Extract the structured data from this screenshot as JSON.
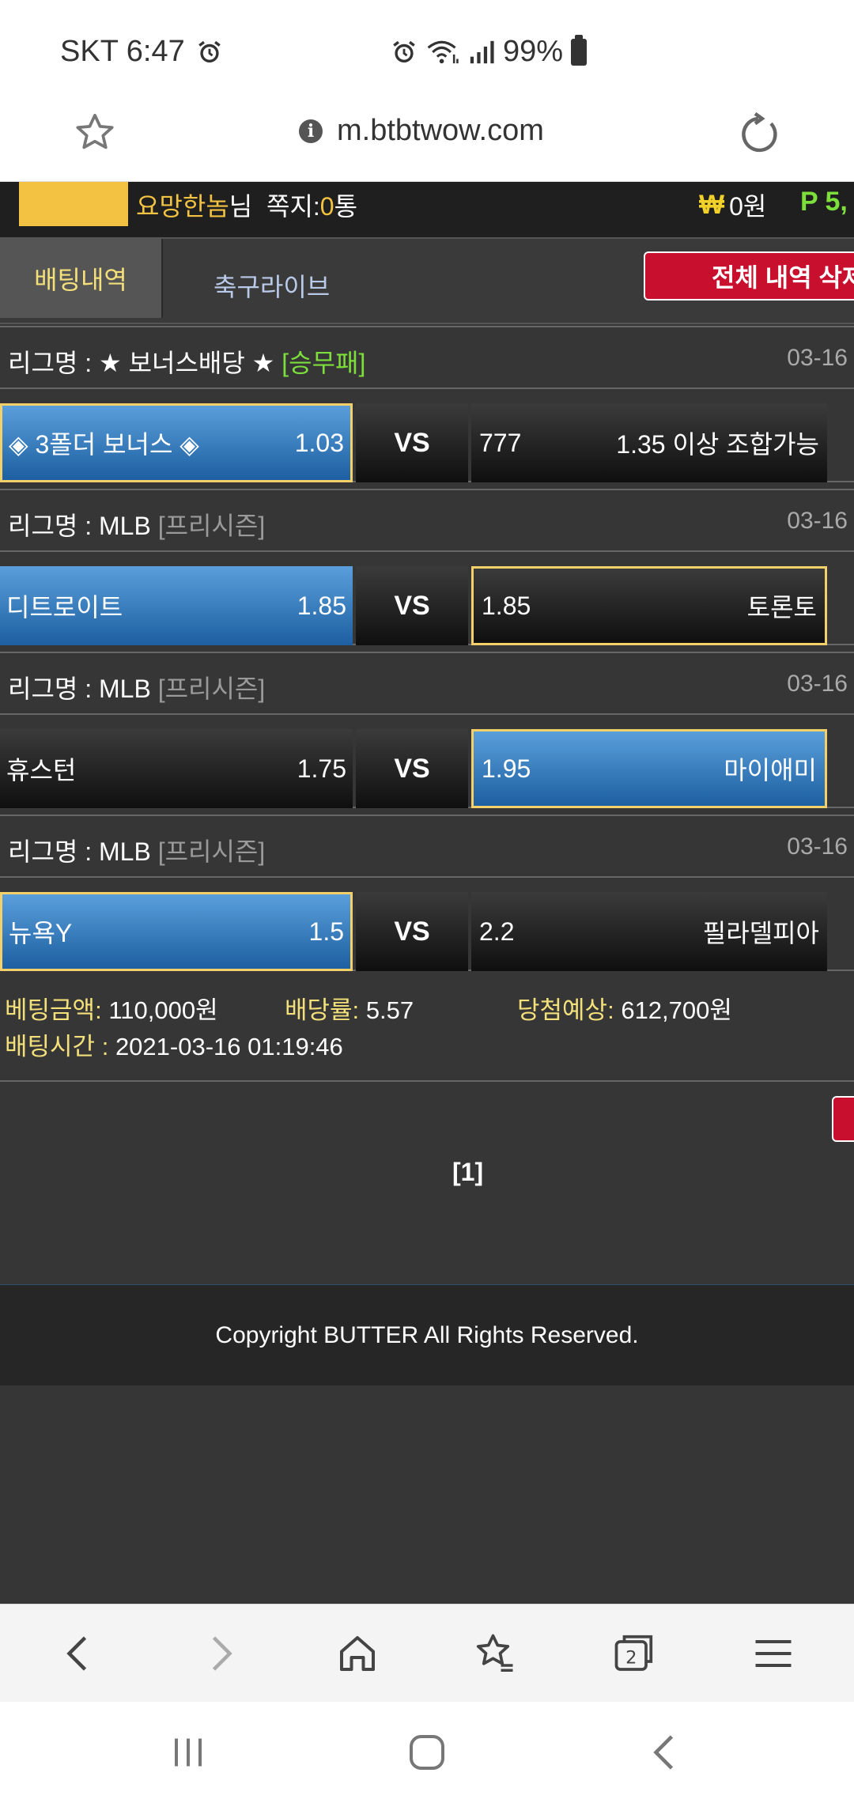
{
  "status_bar": {
    "carrier_time": "SKT 6:47",
    "battery": "99%"
  },
  "browser": {
    "url": "m.btbtwow.com",
    "toolbar_icons": [
      "back-icon",
      "forward-icon",
      "home-icon",
      "bookmarks-icon",
      "tabs-icon",
      "menu-icon"
    ],
    "tab_count": "2"
  },
  "header": {
    "nickname": "요망한놈",
    "honorific": "님",
    "messages_label": "쪽지:",
    "messages_count": "0",
    "messages_unit": "통",
    "money_symbol": "₩",
    "money": "0원",
    "points": "P 5,"
  },
  "tabs": {
    "betting_history": "배팅내역",
    "soccer_live": "축구라이브",
    "delete_all": "전체 내역 삭제"
  },
  "bets": [
    {
      "league_label": "리그명 : ★ 보너스배당 ★",
      "tag": "[승무패]",
      "date": "03-16",
      "home": "◈ 3폴더 보너스 ◈",
      "home_odds": "1.03",
      "vs": "VS",
      "away_odds": "777",
      "away": "1.35 이상 조합가능"
    },
    {
      "league_label": "리그명 : MLB",
      "tag": "[프리시즌]",
      "date": "03-16",
      "home": "디트로이트",
      "home_odds": "1.85",
      "vs": "VS",
      "away_odds": "1.85",
      "away": "토론토"
    },
    {
      "league_label": "리그명 : MLB",
      "tag": "[프리시즌]",
      "date": "03-16",
      "home": "휴스턴",
      "home_odds": "1.75",
      "vs": "VS",
      "away_odds": "1.95",
      "away": "마이애미"
    },
    {
      "league_label": "리그명 : MLB",
      "tag": "[프리시즌]",
      "date": "03-16",
      "home": "뉴욕Y",
      "home_odds": "1.5",
      "vs": "VS",
      "away_odds": "2.2",
      "away": "필라델피아"
    }
  ],
  "summary": {
    "amount_label": "베팅금액:",
    "amount": "110,000원",
    "odds_label": "배당률:",
    "odds": "5.57",
    "expected_label": "당첨예상:",
    "expected": "612,700원",
    "time_label": "배팅시간 :",
    "time": "2021-03-16 01:19:46"
  },
  "pagination": "[1]",
  "footer": "Copyright BUTTER All Rights Reserved."
}
